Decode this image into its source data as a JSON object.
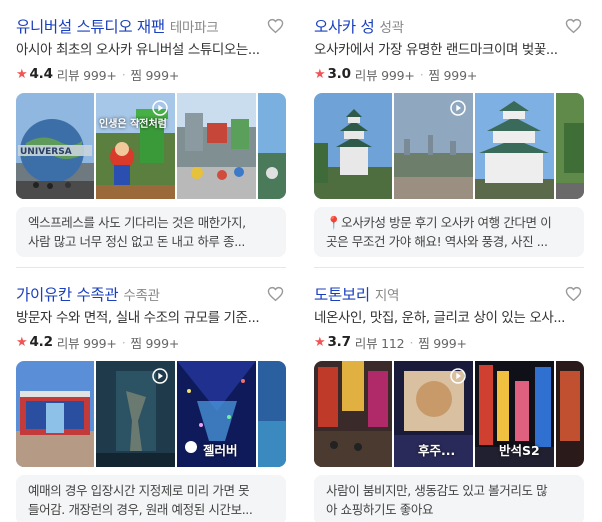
{
  "cards": [
    {
      "title": "유니버설 스튜디오 재팬",
      "category": "테마파크",
      "description": "아시아 최초의 오사카 유니버설 스튜디오는...",
      "rating": "4.4",
      "reviews_label": "리뷰 999+",
      "saves_label": "찜 999+",
      "photo_overlay": "인생은 작전처럼",
      "review_lines": [
        "엑스프레스를 사도 기다리는 것은 매한가지,",
        "사람 많고 너무 정신 없고 돈 내고 하루 종..."
      ]
    },
    {
      "title": "오사카 성",
      "category": "성곽",
      "description": "오사카에서 가장 유명한 랜드마크이며 벚꽃...",
      "rating": "3.0",
      "reviews_label": "리뷰 999+",
      "saves_label": "찜 999+",
      "review_lines": [
        "📍오사카성 방문 후기 오사카 여행 간다면 이",
        "곳은 무조건 가야 해요! 역사와 풍경, 사진 ..."
      ]
    },
    {
      "title": "가이유칸 수족관",
      "category": "수족관",
      "description": "방문자 수와 면적, 실내 수조의 규모를 기준...",
      "rating": "4.2",
      "reviews_label": "리뷰 999+",
      "saves_label": "찜 999+",
      "photo_label": "젤러버",
      "review_lines": [
        "예매의 경우 입장시간 지정제로 미리 가면 못",
        "들어감. 개장런의 경우, 원래 예정된 시간보..."
      ]
    },
    {
      "title": "도톤보리",
      "category": "지역",
      "description": "네온사인, 맛집, 운하, 글리코 상이 있는 오사...",
      "rating": "3.7",
      "reviews_label": "리뷰 112",
      "saves_label": "찜 999+",
      "photo_label_a": "후주...",
      "photo_label_b": "반석S2",
      "review_lines": [
        "사람이 붐비지만, 생동감도 있고 볼거리도 많",
        "아 쇼핑하기도 좋아요"
      ]
    }
  ],
  "colors": {
    "title": "#1a3fbf",
    "star": "#f25454",
    "review_bg": "#f4f5f7"
  },
  "icons": {
    "heart": "heart-outline-icon",
    "star": "star-icon",
    "play": "play-circle-icon"
  }
}
